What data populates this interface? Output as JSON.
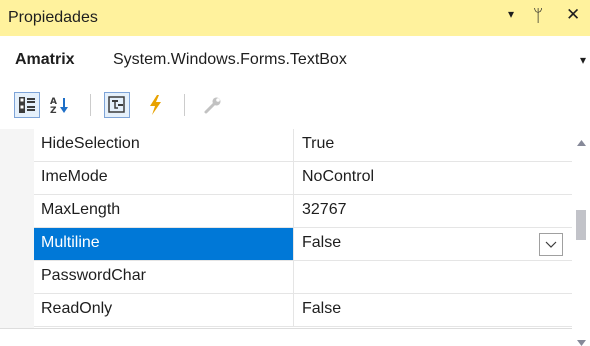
{
  "window": {
    "title": "Propiedades",
    "dropdown_glyph": "▾",
    "pin_glyph": "ᛘ",
    "close_glyph": "✕"
  },
  "object_selector": {
    "name": "Amatrix",
    "type": "System.Windows.Forms.TextBox",
    "dropdown_glyph": "▾"
  },
  "toolbar": {
    "icons": [
      "categorized-icon",
      "alphabetical-sort-icon",
      "properties-icon",
      "events-lightning-icon",
      "property-pages-wrench-icon"
    ]
  },
  "properties": [
    {
      "name": "HideSelection",
      "value": "True",
      "selected": false
    },
    {
      "name": "ImeMode",
      "value": "NoControl",
      "selected": false
    },
    {
      "name": "MaxLength",
      "value": "32767",
      "selected": false
    },
    {
      "name": "Multiline",
      "value": "False",
      "selected": true
    },
    {
      "name": "PasswordChar",
      "value": "",
      "selected": false
    },
    {
      "name": "ReadOnly",
      "value": "False",
      "selected": false
    }
  ],
  "colors": {
    "title_bar": "#fff29d",
    "selection": "#0078d7",
    "events_icon": "#e8a200"
  }
}
